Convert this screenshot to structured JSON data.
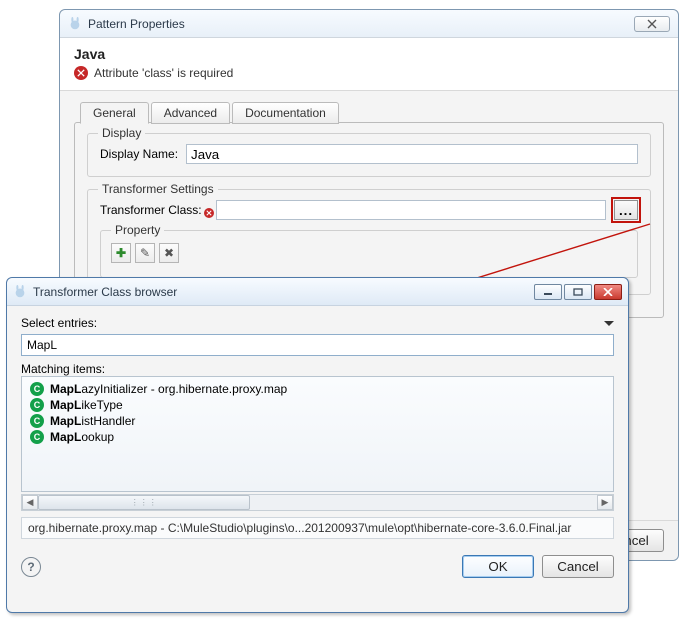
{
  "pattern": {
    "title": "Pattern Properties",
    "header_title": "Java",
    "error_text": "Attribute 'class' is required",
    "tabs": [
      "General",
      "Advanced",
      "Documentation"
    ],
    "active_tab": 0,
    "display_group": "Display",
    "display_name_label": "Display Name:",
    "display_name_value": "Java",
    "transformer_group": "Transformer Settings",
    "transformer_class_label": "Transformer Class:",
    "transformer_class_value": "",
    "browse_label": "...",
    "property_group": "Property",
    "footer_cancel": "Cancel"
  },
  "browser": {
    "title": "Transformer Class browser",
    "select_entries": "Select entries:",
    "search_value": "MapL",
    "matching_label": "Matching items:",
    "items": [
      {
        "bold": "MapL",
        "rest": "azyInitializer - org.hibernate.proxy.map"
      },
      {
        "bold": "MapL",
        "rest": "ikeType"
      },
      {
        "bold": "MapL",
        "rest": "istHandler"
      },
      {
        "bold": "MapL",
        "rest": "ookup"
      }
    ],
    "path": "org.hibernate.proxy.map - C:\\MuleStudio\\plugins\\o...201200937\\mule\\opt\\hibernate-core-3.6.0.Final.jar",
    "ok": "OK",
    "cancel": "Cancel"
  }
}
